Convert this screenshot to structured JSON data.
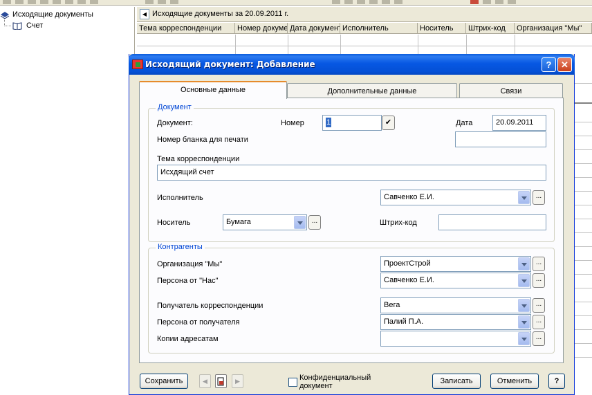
{
  "tree": {
    "root_label": "Исходящие документы",
    "child_label": "Счет"
  },
  "grid": {
    "title": "Исходящие документы за 20.09.2011 г.",
    "columns": [
      "Тема корреспонденции",
      "Номер докуме",
      "Дата документ",
      "Исполнитель",
      "Носитель",
      "Штрих-код",
      "Организация \"Мы\""
    ]
  },
  "dialog": {
    "title": "Исходящий документ: Добавление",
    "help_glyph": "?",
    "close_glyph": "✕",
    "tabs": [
      "Основные данные",
      "Дополнительные данные",
      "Связи"
    ],
    "document_group": {
      "title": "Документ",
      "doc_label": "Документ:",
      "number_label": "Номер",
      "number_value": "1",
      "date_label": "Дата",
      "date_value": "20.09.2011",
      "blank_label": "Номер бланка для печати",
      "blank_value": "",
      "subject_label": "Тема корреспонденции",
      "subject_value": "Исхдящий счет",
      "executor_label": "Исполнитель",
      "executor_value": "Савченко Е.И.",
      "carrier_label": "Носитель",
      "carrier_value": "Бумага",
      "barcode_label": "Штрих-код",
      "barcode_value": ""
    },
    "contractors_group": {
      "title": "Контрагенты",
      "org_label": "Организация \"Мы\"",
      "org_value": "ПроектСтрой",
      "person_us_label": "Персона от \"Нас\"",
      "person_us_value": "Савченко Е.И.",
      "recipient_label": "Получатель корреспонденции",
      "recipient_value": "Вега",
      "recipient_person_label": "Персона от получателя",
      "recipient_person_value": "Палий П.А.",
      "copies_label": "Копии адресатам",
      "copies_value": ""
    },
    "footer": {
      "save_label": "Сохранить",
      "confidential_label": "Конфиденциальный документ",
      "confidential_checked": false,
      "write_label": "Записать",
      "cancel_label": "Отменить",
      "help_label": "?"
    },
    "ellipsis": "...",
    "check_glyph": "✔"
  }
}
